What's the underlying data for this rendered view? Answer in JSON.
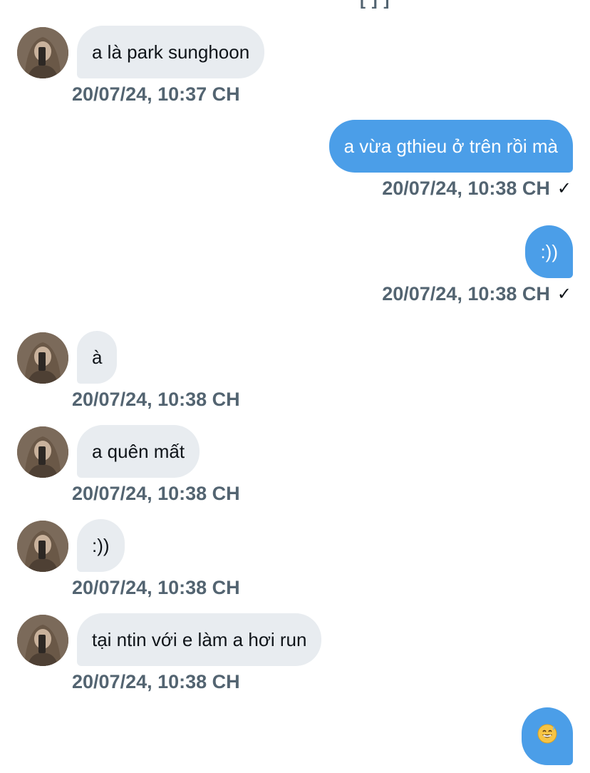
{
  "thread": {
    "cutoff_text": "[ ] ]",
    "messages": [
      {
        "direction": "in",
        "text": "a là park sunghoon",
        "timestamp": "20/07/24, 10:37 CH"
      },
      {
        "direction": "out",
        "text": "a vừa gthieu ở trên rồi mà",
        "timestamp": "20/07/24, 10:38 CH",
        "status": "✓"
      },
      {
        "direction": "out",
        "text": ":))",
        "timestamp": "20/07/24, 10:38 CH",
        "status": "✓"
      },
      {
        "direction": "in",
        "text": "à",
        "timestamp": "20/07/24, 10:38 CH"
      },
      {
        "direction": "in",
        "text": "a quên mất",
        "timestamp": "20/07/24, 10:38 CH"
      },
      {
        "direction": "in",
        "text": ":))",
        "timestamp": "20/07/24, 10:38 CH"
      },
      {
        "direction": "in",
        "text": "tại ntin với e làm a hơi run",
        "timestamp": "20/07/24, 10:38 CH"
      },
      {
        "direction": "out",
        "text": "",
        "emoji": "grinning-sweat-face-emoji"
      }
    ]
  },
  "colors": {
    "incoming_bubble": "#e8ecf0",
    "outgoing_bubble": "#4b9ee8",
    "timestamp_text": "#536471"
  }
}
